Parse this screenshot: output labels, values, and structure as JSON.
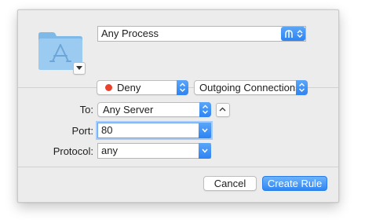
{
  "process": {
    "value": "Any Process"
  },
  "rule": {
    "action": "Deny",
    "direction": "Outgoing Connections",
    "to_label": "To:",
    "to_value": "Any Server",
    "port_label": "Port:",
    "port_value": "80",
    "protocol_label": "Protocol:",
    "protocol_value": "any"
  },
  "buttons": {
    "cancel": "Cancel",
    "create": "Create Rule"
  },
  "colors": {
    "accent": "#2d83f3",
    "deny_dot": "#e8432d",
    "focus_ring": "#a9cbf6"
  },
  "icons": {
    "app_folder": "applications-folder-icon",
    "process_menu": "process-chooser-icon",
    "disclosure": "chevron-down-icon",
    "collapse": "chevron-up-icon"
  }
}
